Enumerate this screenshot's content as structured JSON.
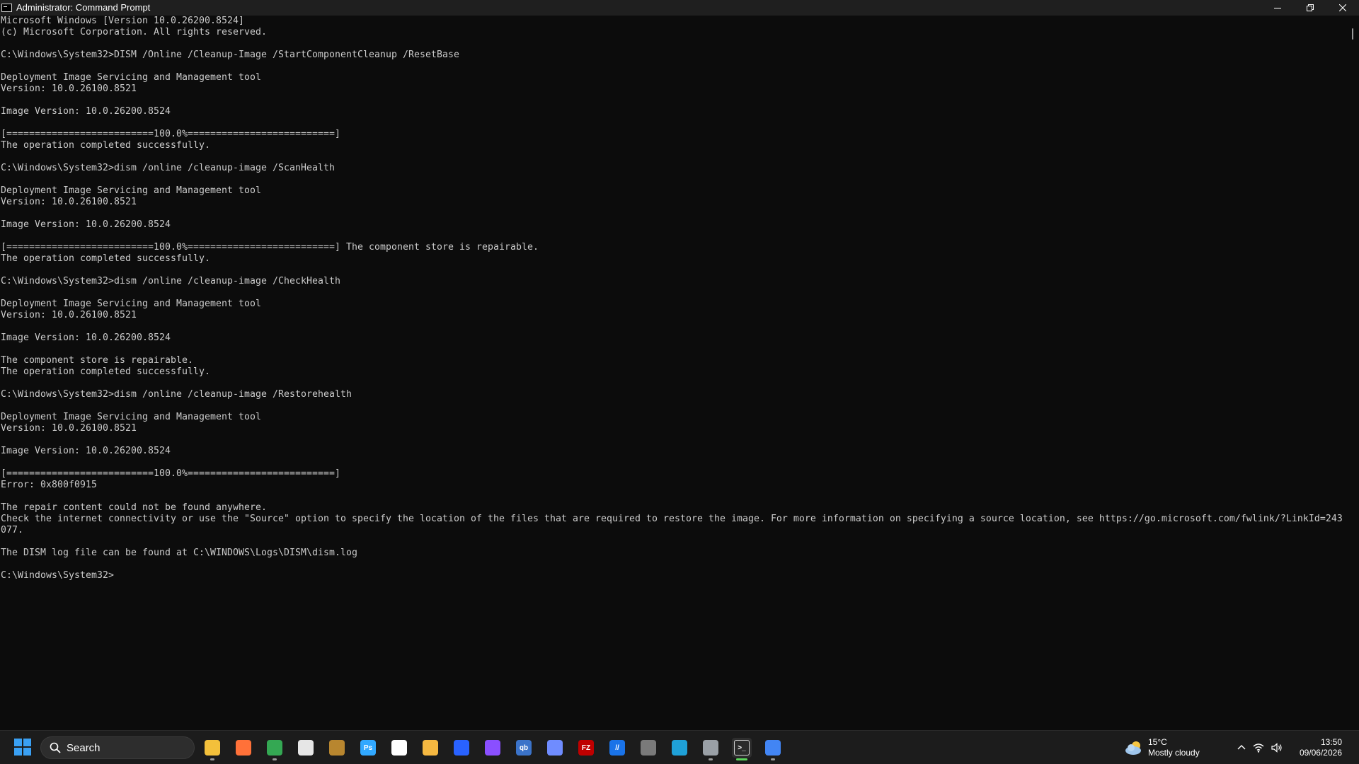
{
  "window": {
    "title": "Administrator: Command Prompt",
    "icon": "cmd-icon"
  },
  "console": {
    "lines": [
      "Microsoft Windows [Version 10.0.26200.8524]",
      "(c) Microsoft Corporation. All rights reserved.",
      "",
      "C:\\Windows\\System32>DISM /Online /Cleanup-Image /StartComponentCleanup /ResetBase",
      "",
      "Deployment Image Servicing and Management tool",
      "Version: 10.0.26100.8521",
      "",
      "Image Version: 10.0.26200.8524",
      "",
      "[==========================100.0%==========================]",
      "The operation completed successfully.",
      "",
      "C:\\Windows\\System32>dism /online /cleanup-image /ScanHealth",
      "",
      "Deployment Image Servicing and Management tool",
      "Version: 10.0.26100.8521",
      "",
      "Image Version: 10.0.26200.8524",
      "",
      "[==========================100.0%==========================] The component store is repairable.",
      "The operation completed successfully.",
      "",
      "C:\\Windows\\System32>dism /online /cleanup-image /CheckHealth",
      "",
      "Deployment Image Servicing and Management tool",
      "Version: 10.0.26100.8521",
      "",
      "Image Version: 10.0.26200.8524",
      "",
      "The component store is repairable.",
      "The operation completed successfully.",
      "",
      "C:\\Windows\\System32>dism /online /cleanup-image /Restorehealth",
      "",
      "Deployment Image Servicing and Management tool",
      "Version: 10.0.26100.8521",
      "",
      "Image Version: 10.0.26200.8524",
      "",
      "[==========================100.0%==========================]",
      "Error: 0x800f0915",
      "",
      "The repair content could not be found anywhere.",
      "Check the internet connectivity or use the \"Source\" option to specify the location of the files that are required to restore the image. For more information on specifying a source location, see https://go.microsoft.com/fwlink/?LinkId=243",
      "077.",
      "",
      "The DISM log file can be found at C:\\WINDOWS\\Logs\\DISM\\dism.log",
      "",
      "C:\\Windows\\System32>"
    ]
  },
  "taskbar": {
    "search_label": "Search",
    "apps": [
      {
        "name": "file-explorer-icon",
        "label": "",
        "color": "#f3c03b",
        "running": true
      },
      {
        "name": "firefox-icon",
        "label": "",
        "color": "#ff7139",
        "running": false
      },
      {
        "name": "chrome-icon",
        "label": "",
        "color": "#34a853",
        "running": true
      },
      {
        "name": "notepad-icon",
        "label": "",
        "color": "#e6e6e6",
        "running": false
      },
      {
        "name": "media-app-icon",
        "label": "",
        "color": "#b8862f",
        "running": false
      },
      {
        "name": "photoshop-icon",
        "label": "Ps",
        "color": "#31a8ff",
        "running": false
      },
      {
        "name": "document-icon",
        "label": "",
        "color": "#ffffff",
        "running": false
      },
      {
        "name": "cleaner-icon",
        "label": "",
        "color": "#f5b841",
        "running": false
      },
      {
        "name": "malwarebytes-icon",
        "label": "",
        "color": "#2962ff",
        "running": false
      },
      {
        "name": "color-app-icon",
        "label": "",
        "color": "#8a4fff",
        "running": false
      },
      {
        "name": "qbittorrent-icon",
        "label": "qb",
        "color": "#3b73c9",
        "running": false
      },
      {
        "name": "vpn-icon",
        "label": "",
        "color": "#6f8cff",
        "running": false
      },
      {
        "name": "filezilla-icon",
        "label": "FZ",
        "color": "#bf0000",
        "running": false
      },
      {
        "name": "editor-icon",
        "label": "//",
        "color": "#1a73e8",
        "running": false
      },
      {
        "name": "calculator-icon",
        "label": "",
        "color": "#7a7a7a",
        "running": false
      },
      {
        "name": "edge-icon",
        "label": "",
        "color": "#1fa1d8",
        "running": false
      },
      {
        "name": "settings-icon",
        "label": "",
        "color": "#9aa0a6",
        "running": true
      },
      {
        "name": "terminal-icon",
        "label": "",
        "color": "#2b2b2b",
        "running": true,
        "active": true
      },
      {
        "name": "docs-icon",
        "label": "",
        "color": "#4285f4",
        "running": true
      }
    ]
  },
  "weather": {
    "temperature": "15°C",
    "condition": "Mostly cloudy"
  },
  "clock": {
    "time": "13:50",
    "date": "09/06/2026"
  }
}
